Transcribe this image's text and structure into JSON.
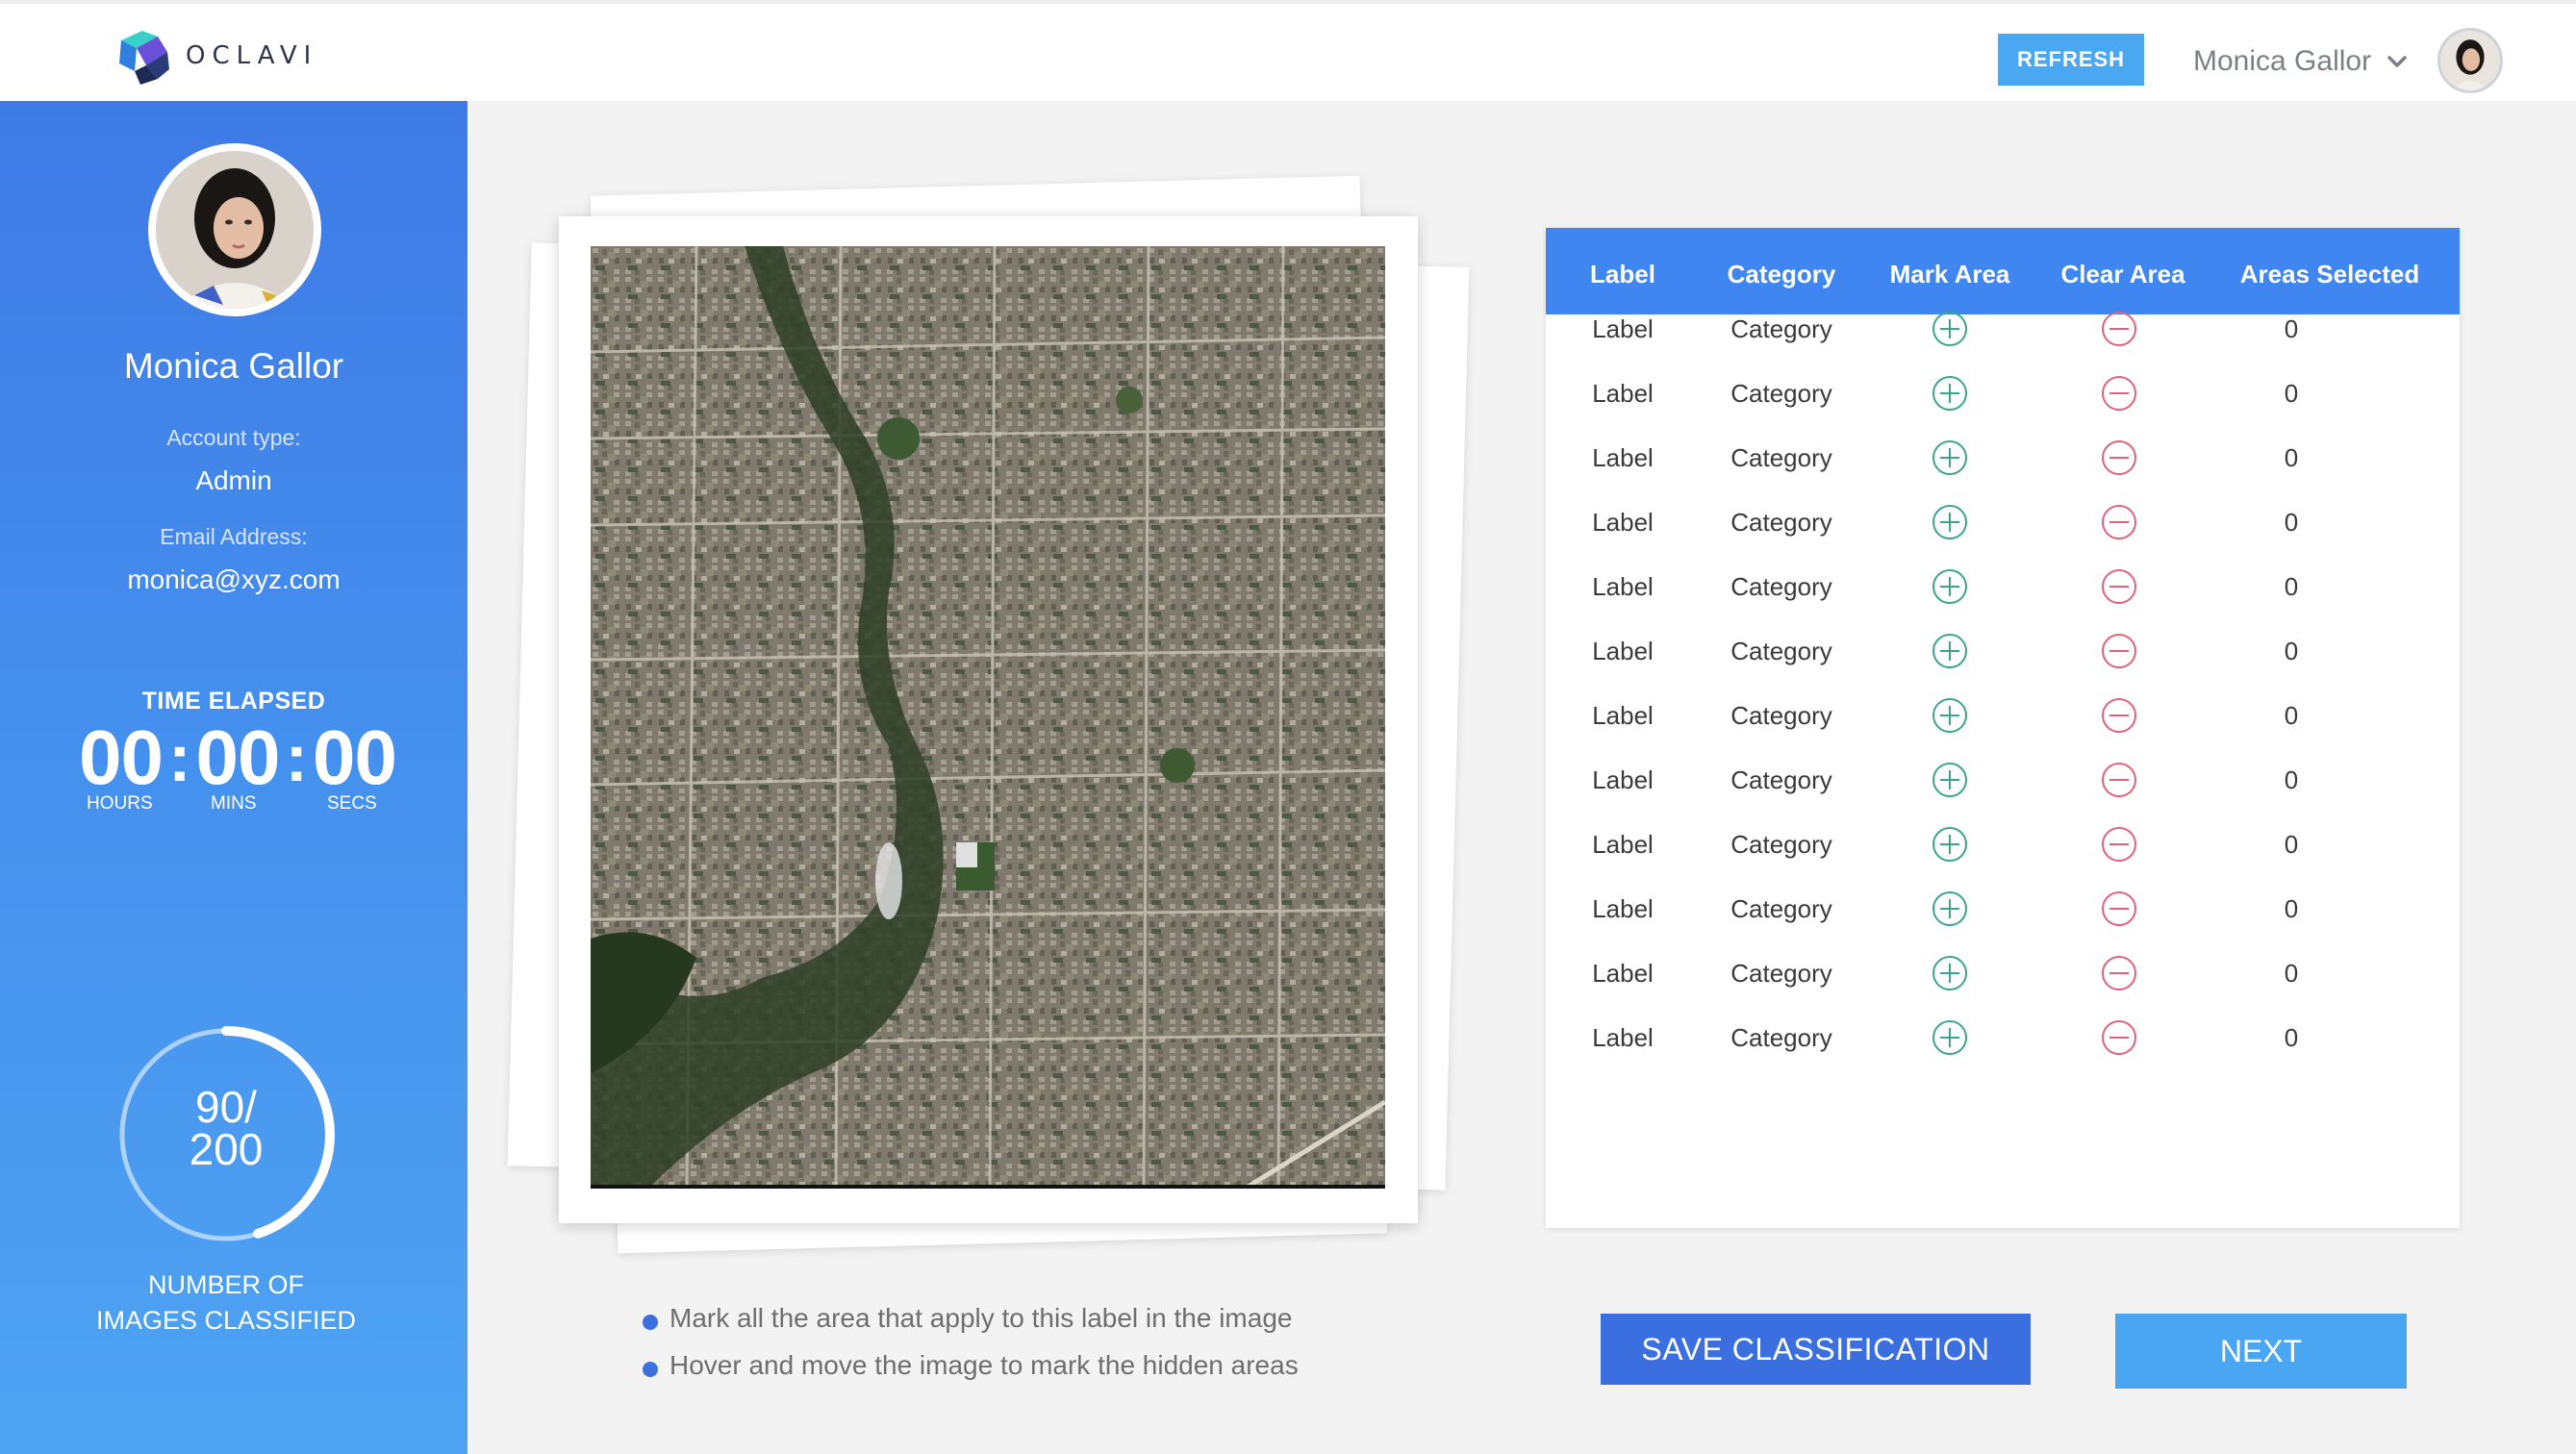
{
  "brand": {
    "name": "OCLAVI"
  },
  "header": {
    "refresh_label": "REFRESH",
    "user_name": "Monica Gallor"
  },
  "sidebar": {
    "name": "Monica Gallor",
    "account_type_label": "Account type:",
    "account_type": "Admin",
    "email_label": "Email Address:",
    "email": "monica@xyz.com",
    "time": {
      "title": "TIME ELAPSED",
      "hours": "00",
      "mins": "00",
      "secs": "00",
      "hours_label": "HOURS",
      "mins_label": "MINS",
      "secs_label": "SECS"
    },
    "progress": {
      "count": "90/",
      "total": "200",
      "fraction": 0.45,
      "label_line1": "NUMBER OF",
      "label_line2": "IMAGES CLASSIFIED"
    }
  },
  "instructions": [
    "Mark all the area that apply to this label in the image",
    "Hover and move the image to mark the hidden areas"
  ],
  "table": {
    "headers": [
      "Label",
      "Category",
      "Mark Area",
      "Clear Area",
      "Areas Selected"
    ],
    "rows": [
      {
        "label": "Label",
        "category": "Category",
        "selected": "0"
      },
      {
        "label": "Label",
        "category": "Category",
        "selected": "0"
      },
      {
        "label": "Label",
        "category": "Category",
        "selected": "0"
      },
      {
        "label": "Label",
        "category": "Category",
        "selected": "0"
      },
      {
        "label": "Label",
        "category": "Category",
        "selected": "0"
      },
      {
        "label": "Label",
        "category": "Category",
        "selected": "0"
      },
      {
        "label": "Label",
        "category": "Category",
        "selected": "0"
      },
      {
        "label": "Label",
        "category": "Category",
        "selected": "0"
      },
      {
        "label": "Label",
        "category": "Category",
        "selected": "0"
      },
      {
        "label": "Label",
        "category": "Category",
        "selected": "0"
      },
      {
        "label": "Label",
        "category": "Category",
        "selected": "0"
      },
      {
        "label": "Label",
        "category": "Category",
        "selected": "0"
      }
    ]
  },
  "actions": {
    "save_label": "SAVE CLASSIFICATION",
    "next_label": "NEXT"
  },
  "colors": {
    "accent_blue": "#3b6fe0",
    "light_blue": "#4aa5f2",
    "mark_green": "#3aa58a",
    "clear_red": "#e0627a"
  },
  "icons": {
    "logo": "oclavi-cube-logo",
    "user_menu": "chevron-down-icon",
    "mark": "plus-circle-icon",
    "clear": "minus-circle-icon"
  }
}
